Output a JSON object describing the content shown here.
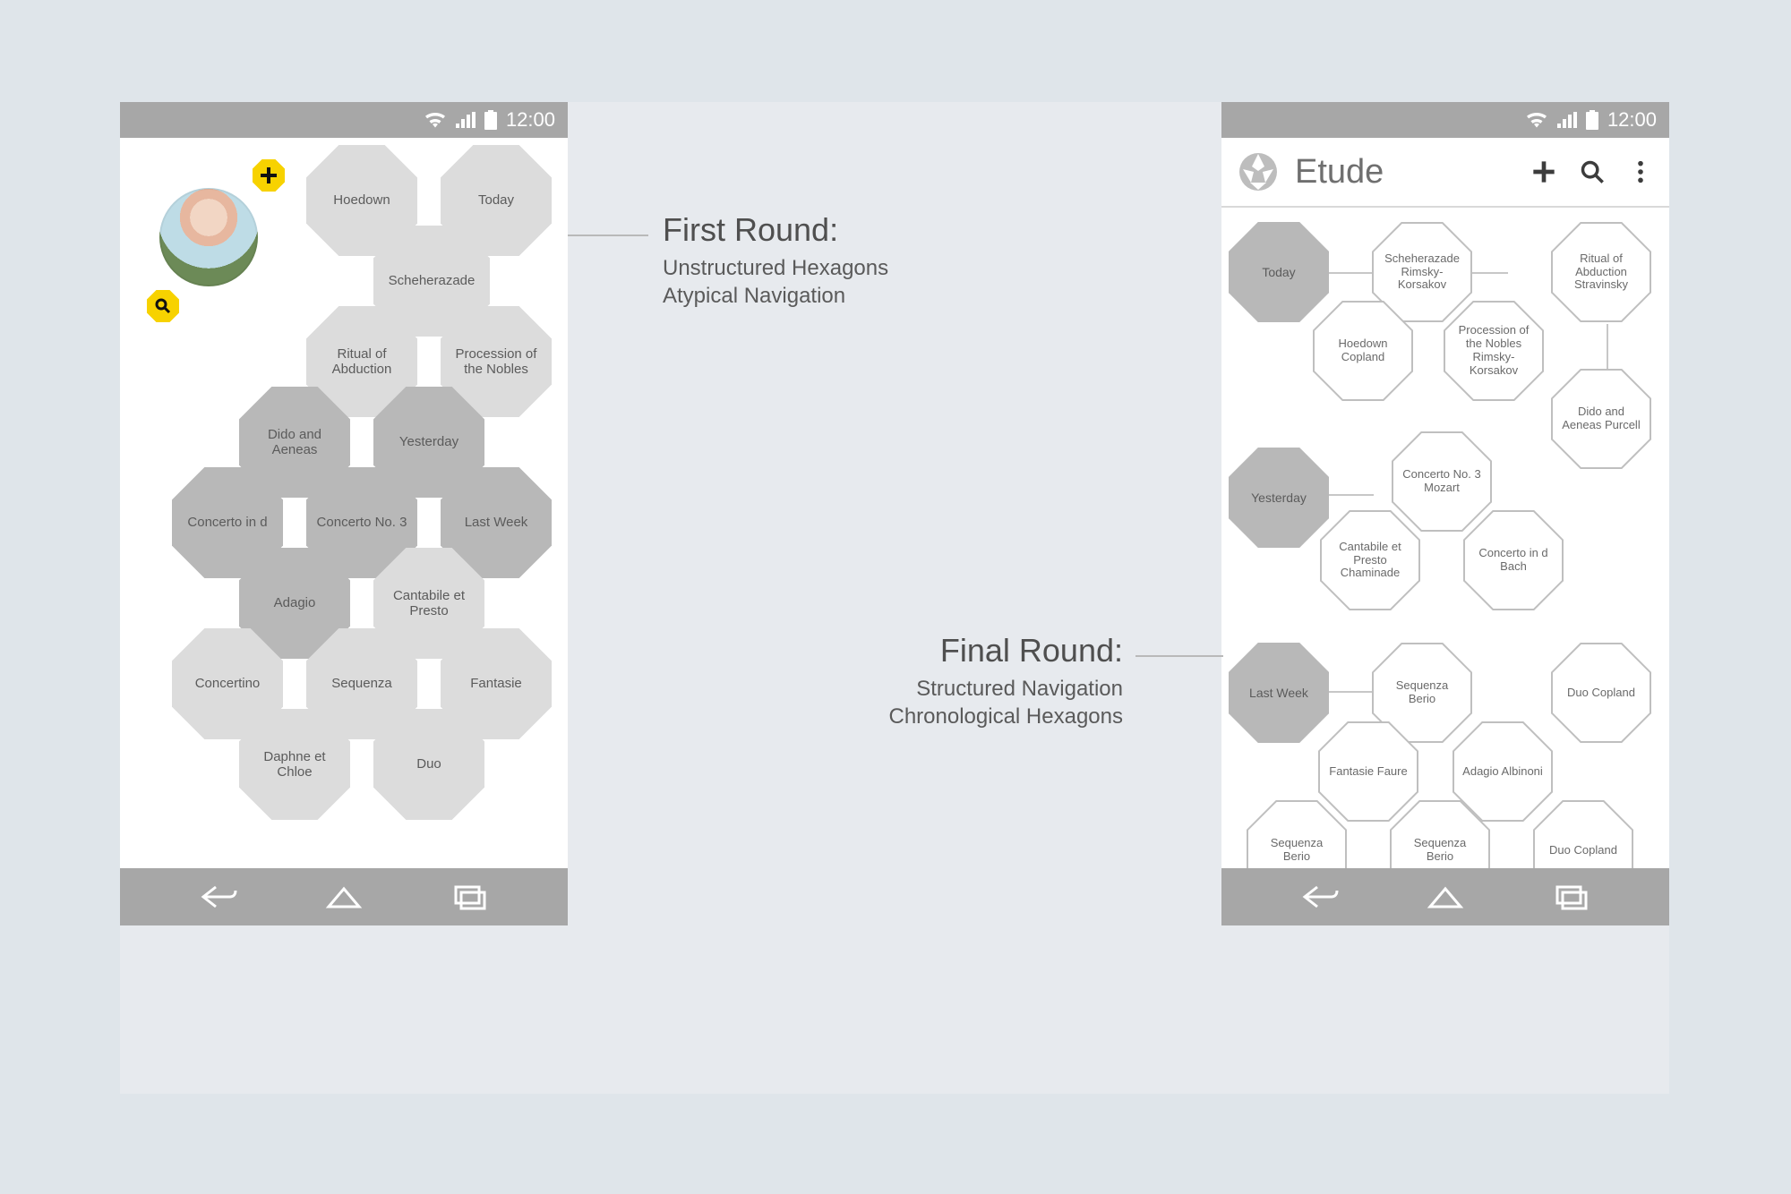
{
  "status": {
    "time": "12:00"
  },
  "captions": {
    "first": {
      "title": "First Round:",
      "line1": "Unstructured Hexagons",
      "line2": "Atypical Navigation"
    },
    "final": {
      "title": "Final Round:",
      "line1": "Structured Navigation",
      "line2": "Chronological Hexagons"
    }
  },
  "left": {
    "tiles": {
      "hoedown": "Hoedown",
      "today": "Today",
      "scheherazade": "Scheherazade",
      "ritual": "Ritual of Abduction",
      "procession": "Procession of the Nobles",
      "dido": "Dido and Aeneas",
      "yesterday": "Yesterday",
      "concerto_d": "Concerto in d",
      "concerto3": "Concerto No. 3",
      "lastweek": "Last Week",
      "adagio": "Adagio",
      "cantabile": "Cantabile et Presto",
      "concertino": "Concertino",
      "sequenza": "Sequenza",
      "fantasie": "Fantasie",
      "daphne": "Daphne et Chloe",
      "duo": "Duo"
    }
  },
  "right": {
    "app_title": "Etude",
    "sections": {
      "today": "Today",
      "yesterday": "Yesterday",
      "lastweek": "Last Week"
    },
    "tiles": {
      "scheherazade": "Scheherazade Rimsky-Korsakov",
      "ritual": "Ritual of Abduction Stravinsky",
      "hoedown": "Hoedown Copland",
      "procession": "Procession of the Nobles Rimsky-Korsakov",
      "dido": "Dido and Aeneas Purcell",
      "concerto3": "Concerto No. 3 Mozart",
      "cantabile": "Cantabile et Presto Chaminade",
      "concerto_d": "Concerto in d Bach",
      "sequenza1": "Sequenza Berio",
      "duo1": "Duo Copland",
      "fantasie": "Fantasie Faure",
      "adagio": "Adagio Albinoni",
      "sequenza2": "Sequenza Berio",
      "sequenza3": "Sequenza Berio",
      "duo2": "Duo Copland"
    }
  }
}
